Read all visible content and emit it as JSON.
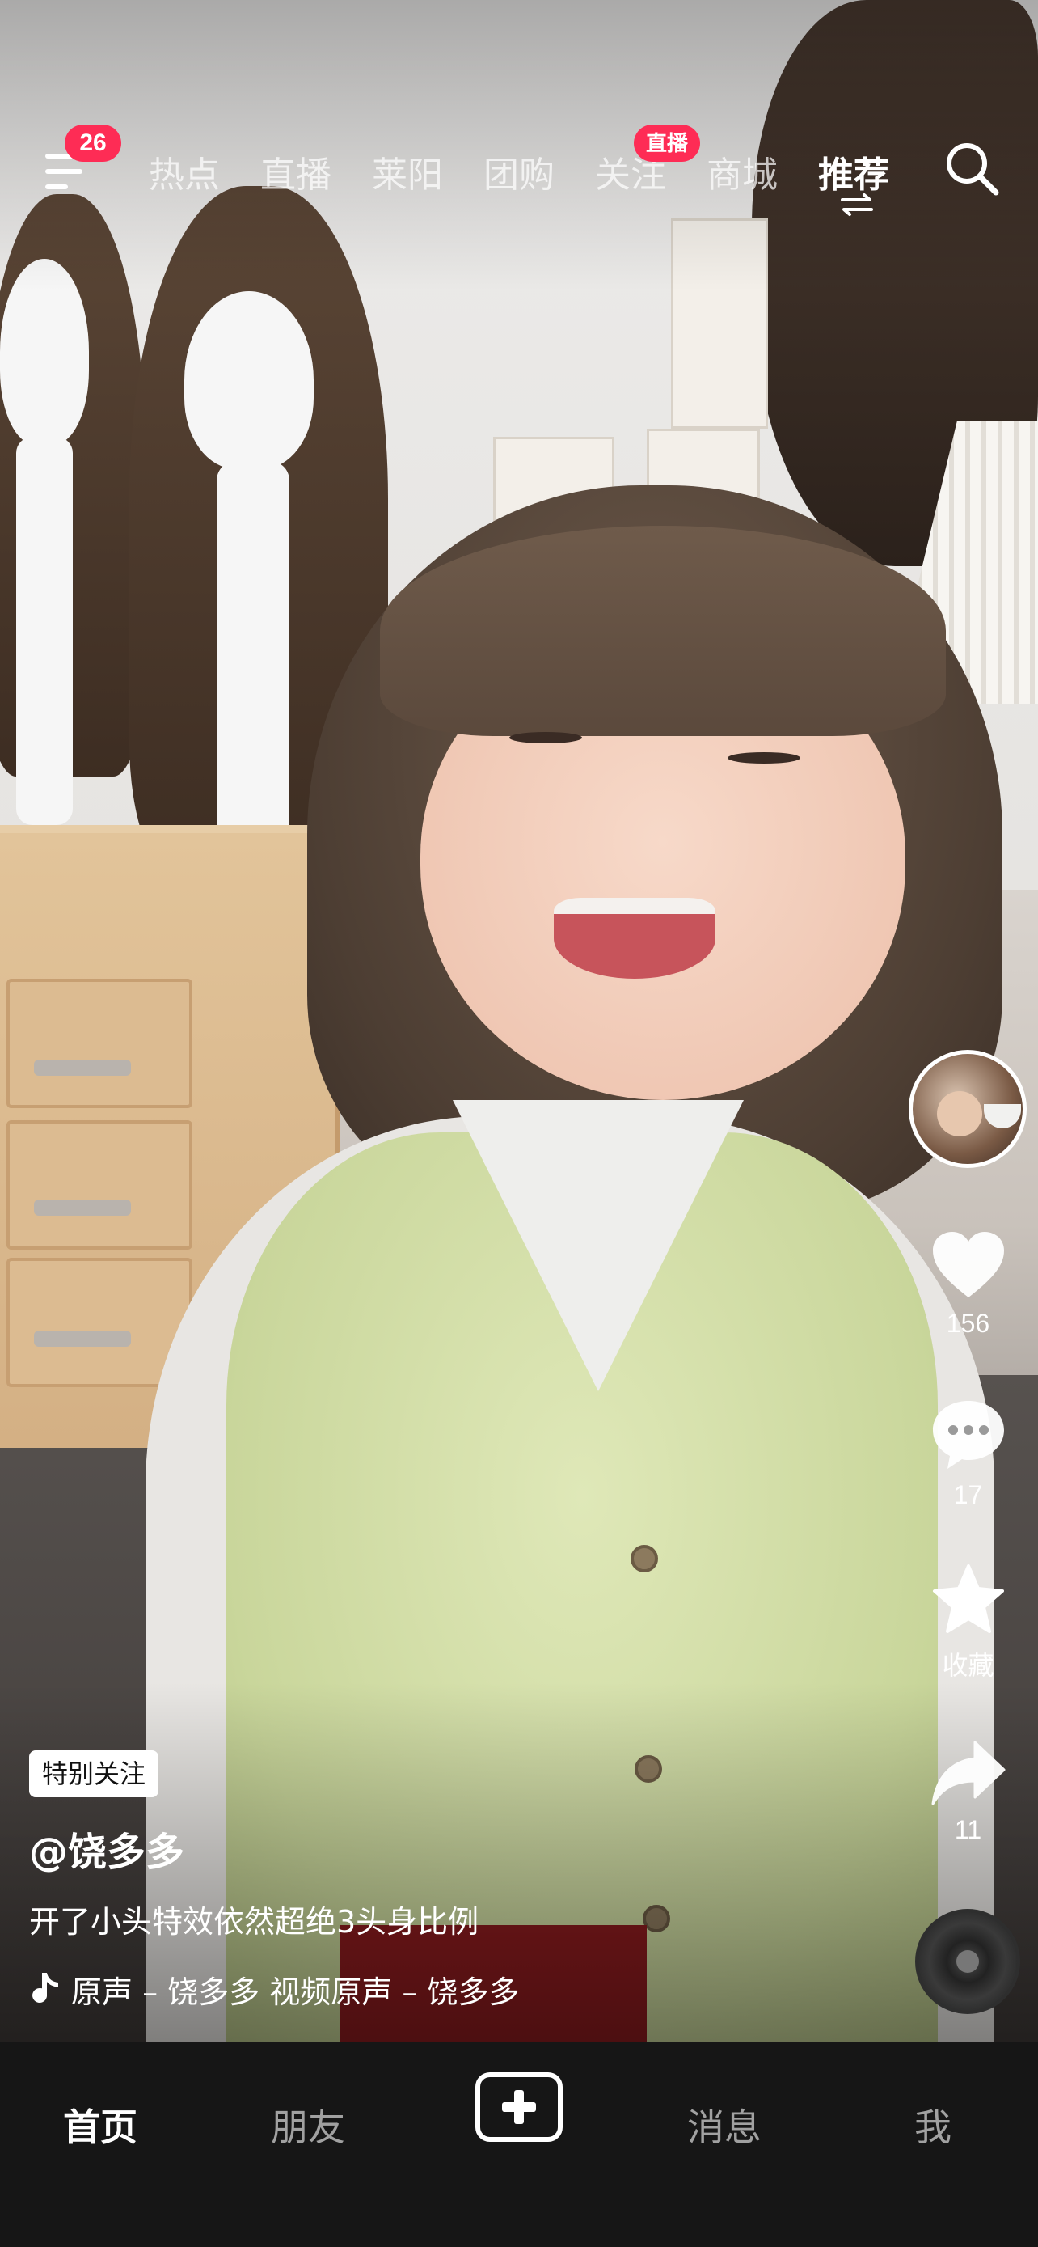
{
  "topnav": {
    "menu_badge": "26",
    "tabs": [
      {
        "label": "热点"
      },
      {
        "label": "直播"
      },
      {
        "label": "莱阳"
      },
      {
        "label": "团购"
      },
      {
        "label": "关注"
      },
      {
        "label": "商城"
      },
      {
        "label": "推荐"
      }
    ],
    "active_tab": "推荐",
    "follow_badge": "直播",
    "icons": [
      "menu-icon",
      "switch-arrows-icon",
      "search-icon"
    ]
  },
  "rail": {
    "likes": "156",
    "comments": "17",
    "favorite_label": "收藏",
    "shares": "11",
    "icons": [
      "avatar",
      "heart-icon",
      "comment-icon",
      "star-icon",
      "share-icon",
      "music-disc-icon"
    ]
  },
  "video_info": {
    "tag": "特别关注",
    "author": "@饶多多",
    "description": "开了小头特效依然超绝3头身比例",
    "music": "原声 – 饶多多    视频原声 – 饶多多"
  },
  "tabbar": {
    "home": "首页",
    "friends": "朋友",
    "messages": "消息",
    "me": "我",
    "active": "首页"
  },
  "colors": {
    "accent_red": "#fe2c55",
    "tabbar_bg": "#161616"
  }
}
